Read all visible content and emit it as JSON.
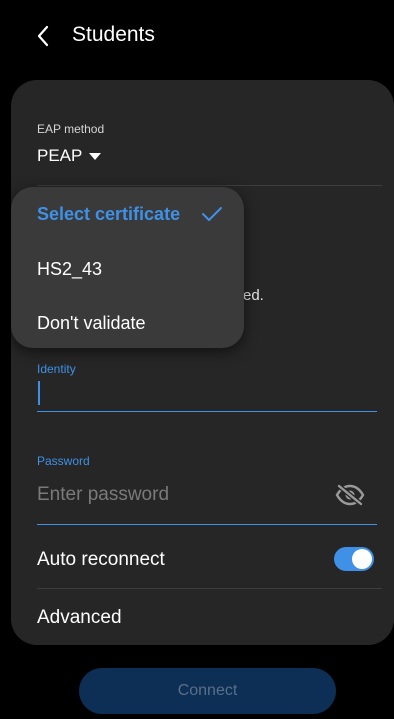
{
  "header": {
    "title": "Students",
    "back_icon": "back-chevron-icon"
  },
  "form": {
    "eap_method": {
      "label": "EAP method",
      "value": "PEAP"
    },
    "obscured_text": "ed.",
    "identity": {
      "label": "Identity",
      "value": ""
    },
    "password": {
      "label": "Password",
      "placeholder": "Enter password",
      "visibility_icon": "eye-off-icon"
    },
    "auto_reconnect": {
      "label": "Auto reconnect",
      "enabled": true
    },
    "advanced_label": "Advanced"
  },
  "certificate_dropdown": {
    "selected": "Select certificate",
    "options": [
      "HS2_43",
      "Don't validate"
    ],
    "check_icon": "checkmark-icon"
  },
  "connect_button": {
    "label": "Connect",
    "enabled": false
  },
  "colors": {
    "accent": "#3e91e6",
    "background": "#000000",
    "card": "#262626",
    "dropdown": "#3a3a3a",
    "button_disabled": "#0d2e55"
  }
}
